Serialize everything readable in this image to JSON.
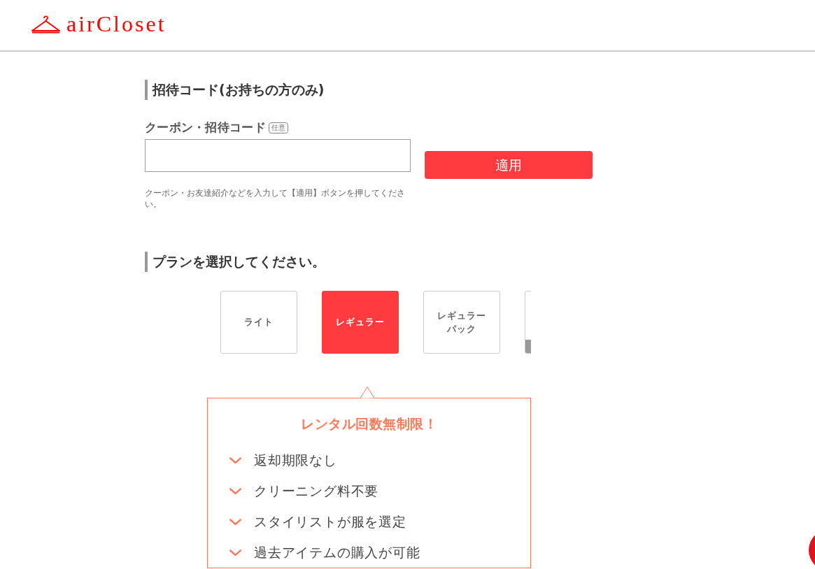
{
  "header": {
    "logo_text": "airCloset"
  },
  "coupon_section": {
    "heading": "招待コード(お持ちの方のみ)",
    "field_label": "クーポン・招待コード",
    "badge": "任意",
    "apply_button": "適用",
    "help_text": "クーポン・お友達紹介などを入力して【適用】ボタンを押してください。"
  },
  "plan_section": {
    "heading": "プランを選択してください。",
    "plans": [
      {
        "label": "ライト",
        "selected": false
      },
      {
        "label": "レギュラー",
        "selected": true
      },
      {
        "label": "レギュラーパック",
        "selected": false
      },
      {
        "selected": false
      }
    ]
  },
  "feature_card": {
    "title": "レンタル回数無制限！",
    "features": [
      "返却期限なし",
      "クリーニング料不要",
      "スタイリストが服を選定",
      "過去アイテムの購入が可能"
    ]
  }
}
